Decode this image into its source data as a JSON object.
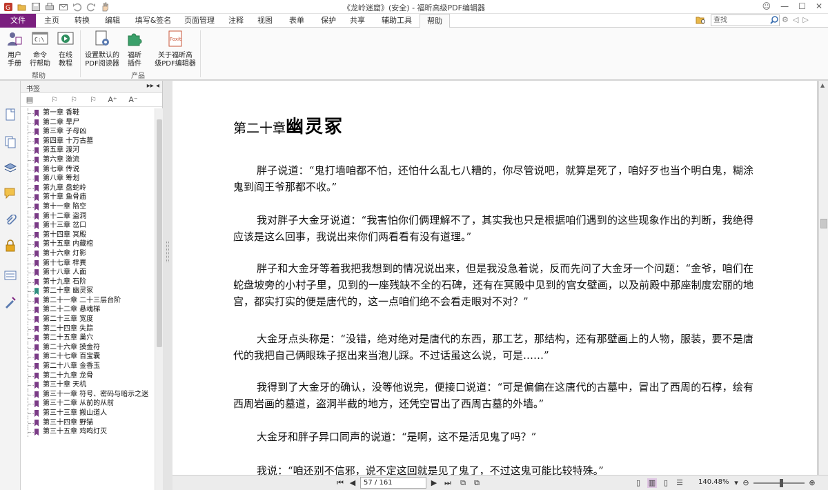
{
  "window": {
    "title": "《龙岭迷窟》(安全) - 福昕高级PDF编辑器",
    "accent_color": "#7a1f7e"
  },
  "qat_icons": [
    "pdf-logo-icon",
    "open-icon",
    "save-icon",
    "print-icon",
    "email-icon",
    "undo-icon",
    "redo-icon",
    "hand-icon"
  ],
  "tabs": [
    {
      "label": "文件",
      "kind": "file"
    },
    {
      "label": "主页"
    },
    {
      "label": "转换"
    },
    {
      "label": "编辑"
    },
    {
      "label": "填写&签名"
    },
    {
      "label": "页面管理"
    },
    {
      "label": "注释"
    },
    {
      "label": "视图"
    },
    {
      "label": "表单"
    },
    {
      "label": "保护"
    },
    {
      "label": "共享"
    },
    {
      "label": "辅助工具"
    },
    {
      "label": "帮助",
      "active": true
    }
  ],
  "search": {
    "placeholder": "查找"
  },
  "ribbon": {
    "help_group": {
      "label": "帮助",
      "buttons": [
        {
          "label_line1": "用户",
          "label_line2": "手册",
          "icon": "user-manual-icon"
        },
        {
          "label_line1": "命令",
          "label_line2": "行帮助",
          "icon": "command-line-icon"
        },
        {
          "label_line1": "在线",
          "label_line2": "教程",
          "icon": "video-tutorial-icon"
        }
      ]
    },
    "product_group": {
      "label": "产品",
      "buttons": [
        {
          "label_line1": "设置默认的",
          "label_line2": "PDF阅读器",
          "icon": "default-reader-icon"
        },
        {
          "label_line1": "福昕",
          "label_line2": "插件",
          "icon": "plugin-icon"
        },
        {
          "label_line1": "关于福昕高",
          "label_line2": "级PDF编辑器",
          "icon": "about-foxit-icon"
        }
      ]
    }
  },
  "left_strip_icons": [
    "page-thumbnail-icon",
    "pages-icon",
    "layers-icon",
    "comments-icon",
    "attachments-icon",
    "security-icon",
    "form-fields-icon",
    "signature-icon"
  ],
  "bookmarks": {
    "header": "书签",
    "items": [
      "第一章 香鞋",
      "第二章 旱尸",
      "第三章 子母凶",
      "第四章 十万古墓",
      "第五章 渡河",
      "第六章 激流",
      "第七章 传说",
      "第八章 筹划",
      "第九章 盘蛇岭",
      "第十章 鱼骨庙",
      "第十一章 陷空",
      "第十二章 盗洞",
      "第十三章 岔口",
      "第十四章 冥殿",
      "第十五章 内藏棺",
      "第十六章 灯影",
      "第十七章 梓異",
      "第十八章 人面",
      "第十九章 石阶",
      "第二十章 幽灵冢",
      "第二十一章 二十三层台阶",
      "第二十二章 悬魂梯",
      "第二十三章 宽度",
      "第二十四章 失踪",
      "第二十五章 巢穴",
      "第二十六章 摸金符",
      "第二十七章 百宝囊",
      "第二十八章 金香玉",
      "第二十九章 龙骨",
      "第三十章 天机",
      "第三十一章 符号、密码与暗示之迷",
      "第三十二章 从前的从前",
      "第三十三章 搬山道人",
      "第三十四章 野猫",
      "第三十五章 鸡鸣灯灭"
    ],
    "current_index": 19
  },
  "document": {
    "chapter_prefix": "第二十章",
    "chapter_name": "幽灵冢",
    "paragraphs": [
      "胖子说道：“鬼打墙咱都不怕，还怕什么乱七八糟的，你尽管说吧，就算是死了，咱好歹也当个明白鬼，糊涂鬼到阎王爷那都不收。”",
      "我对胖子大金牙说道：“我害怕你们俩理解不了，其实我也只是根据咱们遇到的这些现象作出的判断，我绝得应该是这么回事，我说出来你们两看看有没有道理。”",
      "胖子和大金牙等着我把我想到的情况说出来，但是我没急着说，反而先问了大金牙一个问题：“金爷，咱们在蛇盘坡旁的小村子里，见到的一座残缺不全的石碑，还有在冥殿中见到的宫女壁画，以及前殿中那座制度宏丽的地宫，都实打实的便是唐代的，这一点咱们绝不会看走眼对不对？”",
      "大金牙点头称是：“没错，绝对绝对是唐代的东西，那工艺，那结构，还有那壁画上的人物，服装，要不是唐代的我把自己俩眼珠子抠出来当泡儿踩。不过话虽这么说，可是……”",
      "我得到了大金牙的确认，没等他说完，便接口说道：“可是偏偏在这唐代的古墓中，冒出了西周的石椁，绘有西周岩画的墓道，盗洞半截的地方，还凭空冒出了西周古墓的外墙。”",
      "大金牙和胖子异口同声的说道：“是啊，这不是活见鬼了吗？”",
      "我说：“咱还别不信邪，说不定这回就是见了鬼了，不过这鬼可能比较特殊。”"
    ]
  },
  "statusbar": {
    "page_indicator": "57 / 161",
    "zoom": "140.48%"
  }
}
